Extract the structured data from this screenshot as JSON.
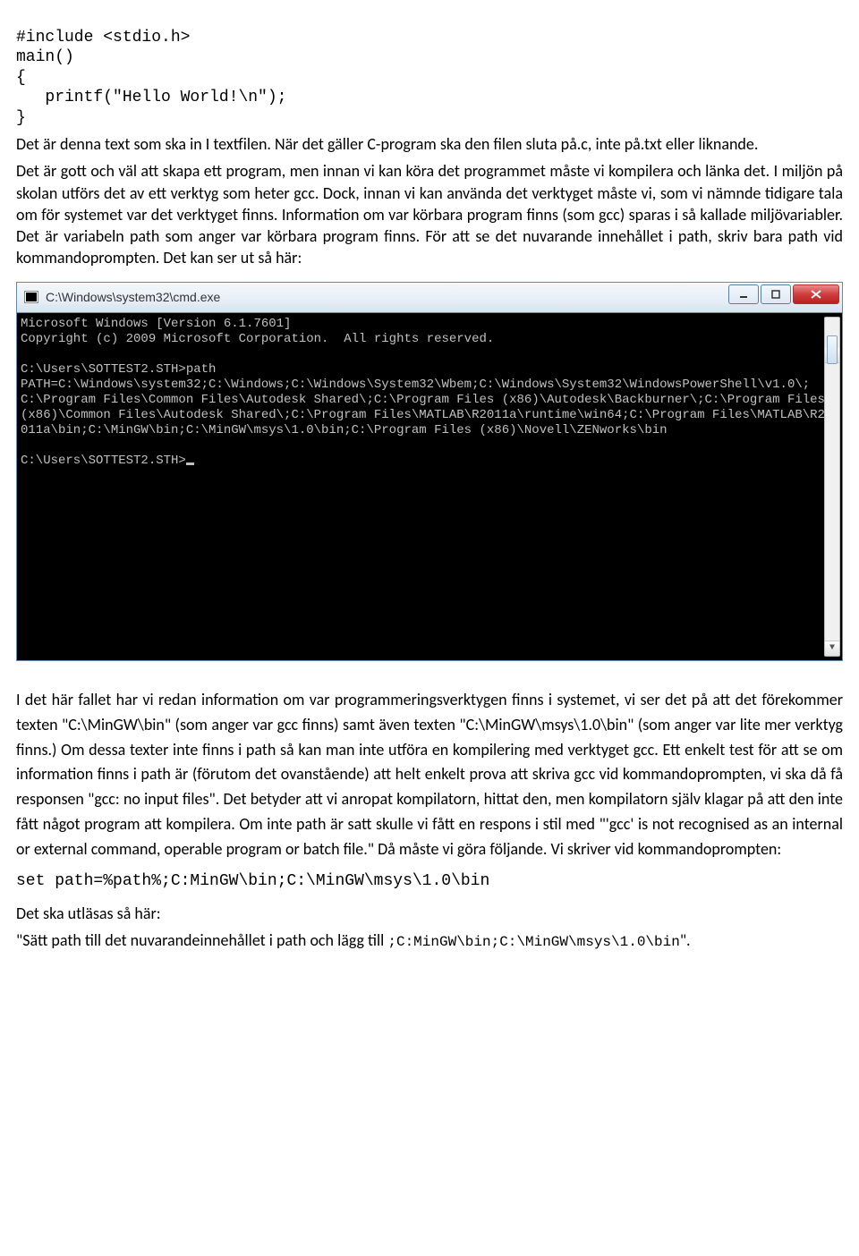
{
  "code": {
    "l1": "#include <stdio.h>",
    "l2": "main()",
    "l3": "{",
    "l4": "   printf(\"Hello World!\\n\");",
    "l5": "}"
  },
  "text": {
    "p1": "Det är denna text som ska in I textfilen. När det gäller C-program ska den filen sluta på.c, inte på.txt eller liknande.",
    "p2": "Det är gott och väl att skapa ett program, men innan vi kan köra det programmet måste vi kompilera och länka det. I miljön på skolan utförs det av ett verktyg som heter gcc. Dock, innan vi kan använda det verktyget måste vi, som vi nämnde tidigare tala om för systemet var det verktyget finns. Information om var körbara program finns (som gcc) sparas i så kallade miljövariabler. Det är variabeln path som anger var körbara program finns. För att se det nuvarande innehållet i path, skriv bara path vid kommandoprompten. Det kan ser ut så här:",
    "p3": "I det här fallet har vi redan information om var programmeringsverktygen finns i systemet, vi ser det på att det förekommer texten \"C:\\MinGW\\bin\" (som anger var gcc finns) samt även texten \"C:\\MinGW\\msys\\1.0\\bin\" (som anger var lite mer verktyg finns.) Om dessa texter inte finns i path så kan man inte utföra en kompilering med verktyget gcc. Ett enkelt test för att se om information finns i path är (förutom det ovanstående) att helt enkelt prova att skriva gcc vid kommandoprompten, vi ska då få responsen \"gcc: no input files\". Det betyder att vi anropat kompilatorn, hittat den, men kompilatorn själv klagar på att den inte fått något program att kompilera. Om inte path är satt skulle vi fått en respons i stil med \"'gcc' is not recognised as an internal or external command, operable program or batch file.\" Då måste vi göra följande. Vi skriver vid kommandoprompten:",
    "p4": "Det ska utläsas så här:",
    "p5a": "\"Sätt path till det nuvarandeinnehållet i path och lägg till ",
    "p5b": ";C:MinGW\\bin;C:\\MinGW\\msys\\1.0\\bin",
    "p5c": "\"."
  },
  "commands": {
    "setpath": "set path=%path%;C:MinGW\\bin;C:\\MinGW\\msys\\1.0\\bin"
  },
  "terminal": {
    "title": "C:\\Windows\\system32\\cmd.exe",
    "body": "Microsoft Windows [Version 6.1.7601]\nCopyright (c) 2009 Microsoft Corporation.  All rights reserved.\n\nC:\\Users\\SOTTEST2.STH>path\nPATH=C:\\Windows\\system32;C:\\Windows;C:\\Windows\\System32\\Wbem;C:\\Windows\\System32\\WindowsPowerShell\\v1.0\\;C:\\Program Files\\Common Files\\Autodesk Shared\\;C:\\Program Files (x86)\\Autodesk\\Backburner\\;C:\\Program Files (x86)\\Common Files\\Autodesk Shared\\;C:\\Program Files\\MATLAB\\R2011a\\runtime\\win64;C:\\Program Files\\MATLAB\\R2011a\\bin;C:\\MinGW\\bin;C:\\MinGW\\msys\\1.0\\bin;C:\\Program Files (x86)\\Novell\\ZENworks\\bin\n\nC:\\Users\\SOTTEST2.STH>"
  }
}
